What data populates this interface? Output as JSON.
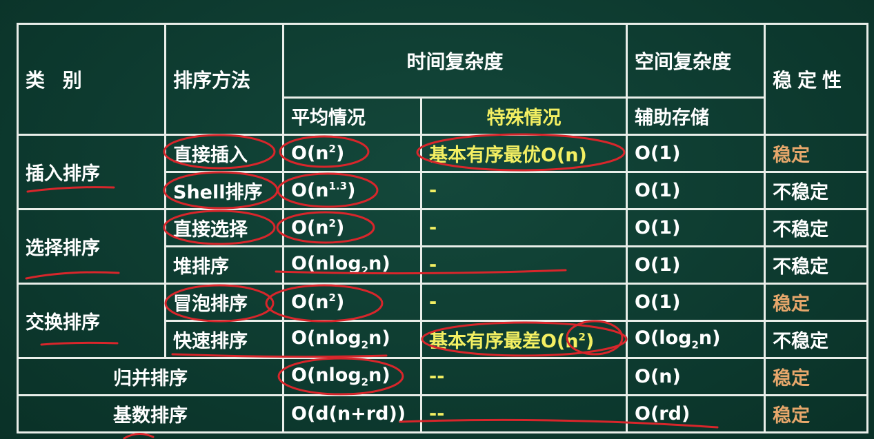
{
  "header": {
    "category": "类 别",
    "method": "排序方法",
    "time_complexity": "时间复杂度",
    "space_complexity": "空间复杂度",
    "stability": "稳定性",
    "average": "平均情况",
    "special": "特殊情况",
    "auxiliary": "辅助存储"
  },
  "groups": {
    "insertion": "插入排序",
    "selection": "选择排序",
    "exchange": "交换排序"
  },
  "rows": [
    {
      "method": "直接插入",
      "avg_base": "O(n",
      "avg_exp": "2",
      "avg_tail": ")",
      "special": "基本有序最优O(n)",
      "space": "O(1)",
      "stability": "稳定"
    },
    {
      "method": "Shell排序",
      "avg_base": "O(n",
      "avg_exp": "1.3",
      "avg_tail": ")",
      "special": "-",
      "space": "O(1)",
      "stability": "不稳定"
    },
    {
      "method": "直接选择",
      "avg_base": "O(n",
      "avg_exp": "2",
      "avg_tail": ")",
      "special": "-",
      "space": "O(1)",
      "stability": "不稳定"
    },
    {
      "method": "堆排序",
      "avg_base": "O(nlog",
      "avg_sub": "2",
      "avg_tail": "n)",
      "special": "-",
      "space": "O(1)",
      "stability": "不稳定"
    },
    {
      "method": "冒泡排序",
      "avg_base": "O(n",
      "avg_exp": "2",
      "avg_tail": ")",
      "special": "-",
      "space": "O(1)",
      "stability": "稳定"
    },
    {
      "method": "快速排序",
      "avg_base": "O(nlog",
      "avg_sub": "2",
      "avg_tail": "n)",
      "special_base": "基本有序最差O(n",
      "special_exp": "2",
      "special_tail": ")",
      "space_base": "O(log",
      "space_sub": "2",
      "space_tail": "n)",
      "stability": "不稳定"
    },
    {
      "method": "归并排序",
      "avg_base": "O(nlog",
      "avg_sub": "2",
      "avg_tail": "n)",
      "special": "--",
      "space": "O(n)",
      "stability": "稳定"
    },
    {
      "method": "基数排序",
      "avg": "O(d(n+rd))",
      "special": "--",
      "space": "O(rd)",
      "stability": "稳定"
    }
  ],
  "colors": {
    "board": "#0e3b30",
    "line": "#e9eee9",
    "text": "#ffffff",
    "highlight_yellow": "#f3ef62",
    "stable_orange": "#e7a76b",
    "annotation_red": "#d8262b"
  }
}
